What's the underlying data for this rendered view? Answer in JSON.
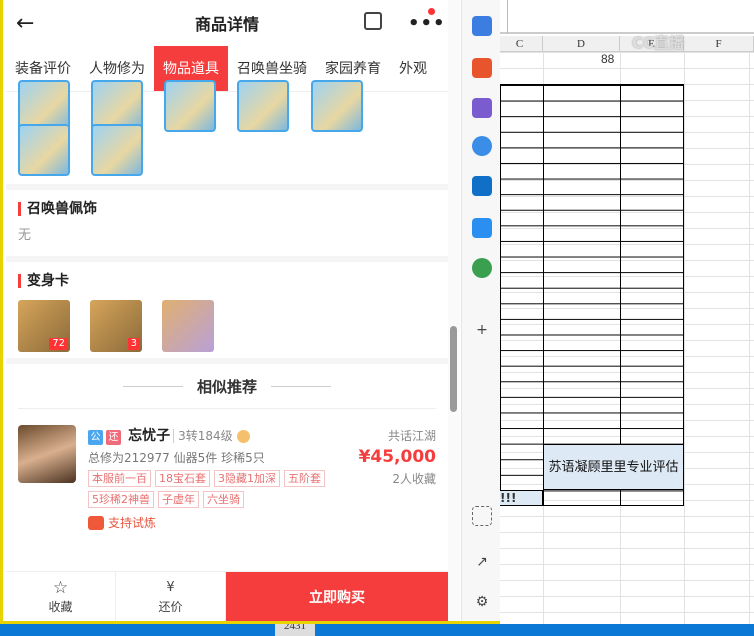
{
  "app": {
    "title": "商品详情",
    "back_icon": "←",
    "more_icon": "•••",
    "tabs": [
      "装备评价",
      "人物修为",
      "物品道具",
      "召唤兽坐骑",
      "家园养育",
      "外观"
    ],
    "active_tab": 2,
    "sections": {
      "pet_accessory": {
        "title": "召唤兽佩饰",
        "value": "无"
      },
      "transform_card": {
        "title": "变身卡",
        "cards": [
          {
            "count": "72"
          },
          {
            "count": "3"
          },
          {
            "count": ""
          }
        ]
      }
    },
    "recommend_title": "相似推荐",
    "listing": {
      "badge1": "公",
      "badge2": "还",
      "name": "忘忧子",
      "level": "3转184级",
      "stats": "总修为212977  仙器5件  珍稀5只",
      "tags": [
        "本服前一百",
        "18宝石套",
        "3隐藏1加深",
        "五阶套",
        "5珍稀2神兽",
        "子虚年",
        "六坐骑"
      ],
      "trial": "支持试炼",
      "server": "共话江湖",
      "price": "¥45,000",
      "favorites": "2人收藏"
    },
    "bottom": {
      "fav_icon": "☆",
      "fav_label": "收藏",
      "bargain_icon": "¥",
      "bargain_label": "还价",
      "buy_label": "立即购买"
    }
  },
  "excel": {
    "col_headers": [
      "C",
      "D",
      "E",
      "F"
    ],
    "d_value": "88",
    "merged_text": "苏语凝顾里里专业评估",
    "exclaim": "!!!",
    "bottom_cell": "2431",
    "watermark": "CC直播"
  }
}
